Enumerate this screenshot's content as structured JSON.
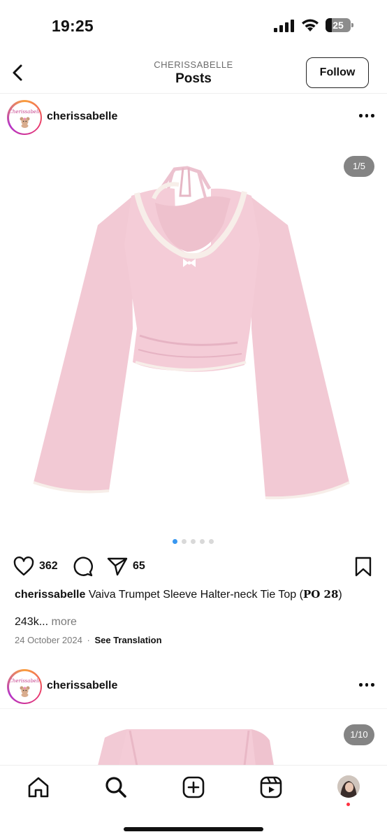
{
  "status_bar": {
    "time": "19:25",
    "battery": "25",
    "battery_level": 0.25
  },
  "header": {
    "subtitle": "CHERISSABELLE",
    "title": "Posts",
    "follow_label": "Follow",
    "back_icon": "chevron-left-icon"
  },
  "posts": [
    {
      "username": "cherissabelle",
      "avatar_text": "Cherissabelle",
      "counter": "1/5",
      "dots_total": 5,
      "dots_active": 0,
      "likes": "362",
      "shares": "65",
      "caption_user": "cherissabelle",
      "caption_text": "Vaiva Trumpet Sleeve Halter-neck Tie Top (",
      "caption_code": "PO 28",
      "caption_end": ")",
      "views": "243k...",
      "more_label": "more",
      "date": "24 October 2024",
      "separator": "·",
      "translation_label": "See Translation"
    },
    {
      "username": "cherissabelle",
      "avatar_text": "Cherissabelle",
      "counter": "1/10"
    }
  ],
  "nav": {
    "items": [
      "home-icon",
      "search-icon",
      "create-icon",
      "reels-icon",
      "profile-avatar"
    ]
  },
  "colors": {
    "accent": "#3897f0",
    "garment": "#f2c9d4",
    "lace": "#f7eee9",
    "notification": "#ff3040"
  }
}
